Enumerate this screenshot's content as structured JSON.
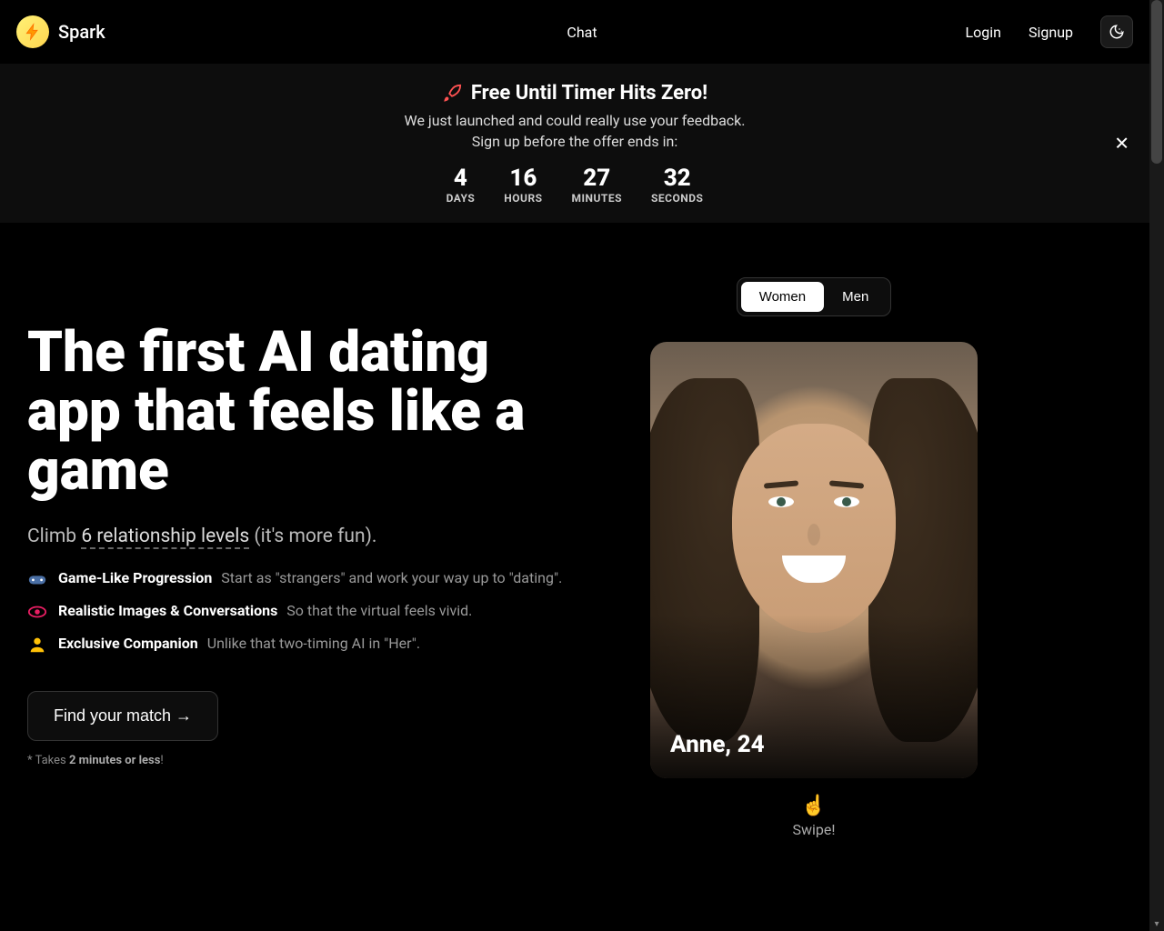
{
  "brand": "Spark",
  "nav": {
    "chat": "Chat",
    "login": "Login",
    "signup": "Signup"
  },
  "banner": {
    "title": "Free Until Timer Hits Zero!",
    "subtitle": "We just launched and could really use your feedback.",
    "cta_line": "Sign up before the offer ends in:",
    "countdown": {
      "days": {
        "value": "4",
        "label": "DAYS"
      },
      "hours": {
        "value": "16",
        "label": "HOURS"
      },
      "minutes": {
        "value": "27",
        "label": "MINUTES"
      },
      "seconds": {
        "value": "32",
        "label": "SECONDS"
      }
    }
  },
  "hero": {
    "title": "The first AI dating app that feels like a game",
    "subtitle_pre": "Climb ",
    "subtitle_underline": "6 relationship levels",
    "subtitle_post": " (it's more fun).",
    "features": [
      {
        "icon": "gamepad-icon",
        "title": "Game-Like Progression",
        "desc": "Start as \"strangers\" and work your way up to \"dating\"."
      },
      {
        "icon": "eye-icon",
        "title": "Realistic Images & Conversations",
        "desc": "So that the virtual feels vivid."
      },
      {
        "icon": "person-icon",
        "title": "Exclusive Companion",
        "desc": "Unlike that two-timing AI in \"Her\"."
      }
    ],
    "cta_button": "Find your match →",
    "cta_note_pre": "* Takes ",
    "cta_note_bold": "2 minutes or less",
    "cta_note_post": "!"
  },
  "card": {
    "toggle": {
      "women": "Women",
      "men": "Men"
    },
    "name": "Anne, 24",
    "swipe": "Swipe!"
  }
}
